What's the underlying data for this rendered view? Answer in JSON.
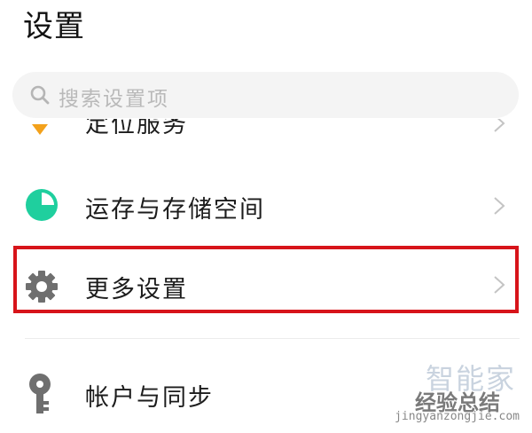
{
  "page": {
    "title": "设置"
  },
  "search": {
    "placeholder": "搜索设置项"
  },
  "settings_items": [
    {
      "label": "定位服务",
      "icon": "location-icon",
      "color": "#f3a11b"
    },
    {
      "label": "运存与存储空间",
      "icon": "storage-pie-icon",
      "color": "#1fcf9e"
    },
    {
      "label": "更多设置",
      "icon": "gear-icon",
      "color": "#6f6f6f"
    },
    {
      "label": "帐户与同步",
      "icon": "key-icon",
      "color": "#6f6f6f"
    }
  ],
  "highlight": {
    "color": "#d7141a"
  },
  "watermark": {
    "logo": "智能家",
    "brand": "经验总结",
    "url": "jingyanzongjie.com"
  }
}
